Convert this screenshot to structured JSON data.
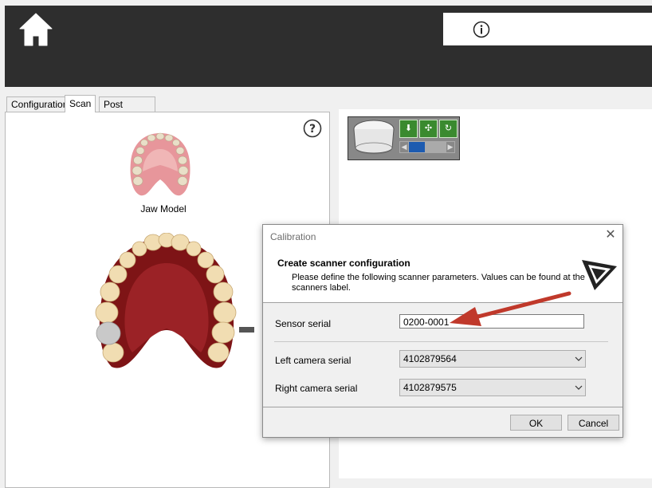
{
  "tabs": [
    {
      "label": "Configuration"
    },
    {
      "label": "Scan"
    },
    {
      "label": "Post Processing"
    }
  ],
  "left_panel": {
    "jaw_model_label": "Jaw Model"
  },
  "dialog": {
    "title": "Calibration",
    "heading": "Create scanner configuration",
    "description": "Please define the following scanner parameters. Values can be found at the scanners label.",
    "sensor_serial_label": "Sensor serial",
    "sensor_serial_value": "0200-0001",
    "left_camera_label": "Left camera serial",
    "left_camera_value": "4102879564",
    "right_camera_label": "Right camera serial",
    "right_camera_value": "4102879575",
    "ok_label": "OK",
    "cancel_label": "Cancel",
    "close_glyph": "✕"
  },
  "colors": {
    "topbar": "#2e2e2e",
    "arrow": "#c0392b",
    "gum": "#8b1a1a",
    "tooth": "#f0dcb0"
  }
}
